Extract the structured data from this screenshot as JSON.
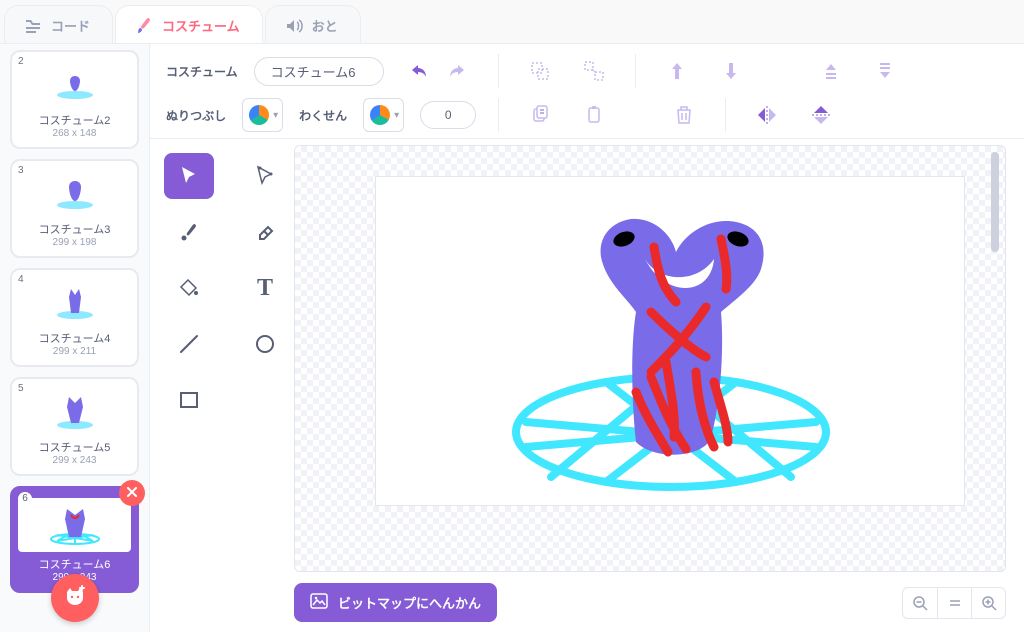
{
  "tabs": {
    "code": "コード",
    "costumes": "コスチューム",
    "sounds": "おと",
    "active": "costumes"
  },
  "costume_list": [
    {
      "num": "2",
      "name": "コスチューム2",
      "size": "268 x 148"
    },
    {
      "num": "3",
      "name": "コスチューム3",
      "size": "299 x 198"
    },
    {
      "num": "4",
      "name": "コスチューム4",
      "size": "299 x 211"
    },
    {
      "num": "5",
      "name": "コスチューム5",
      "size": "299 x 243"
    },
    {
      "num": "6",
      "name": "コスチューム6",
      "size": "299 x 243",
      "selected": true
    }
  ],
  "toolbar": {
    "name_label": "コスチューム",
    "name_value": "コスチューム6",
    "fill_label": "ぬりつぶし",
    "outline_label": "わくせん",
    "outline_width": "0"
  },
  "buttons": {
    "convert_bitmap": "ビットマップにへんかん"
  },
  "icons": {
    "undo": "↶",
    "redo": "↷",
    "group": "⿺",
    "ungroup": "⿻",
    "front": "⬆",
    "back": "⬇",
    "forward": "⇡",
    "backward": "⇣",
    "copy": "⎘",
    "paste": "⎗",
    "trash": "🗑",
    "fliph": "⇋",
    "flipv": "⇵",
    "delete": "✕",
    "zoom_out": "−",
    "zoom_reset": "=",
    "zoom_in": "+"
  },
  "colors": {
    "accent": "#855cd6",
    "accent_light": "#c7b9ef",
    "danger": "#ff5f5f",
    "pentagram": "#40e7ff",
    "creature": "#7a6ce8",
    "scratch_red": "#ea2a2a"
  }
}
